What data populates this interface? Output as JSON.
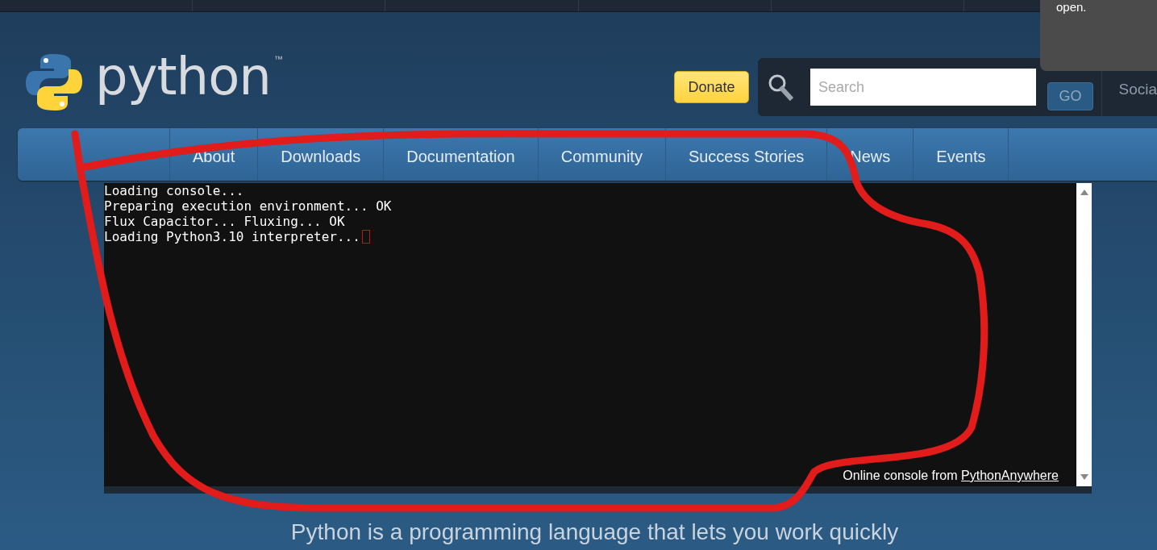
{
  "tooltip": {
    "text": "open."
  },
  "logo": {
    "wordmark": "python",
    "trademark": "™"
  },
  "donate_button": "Donate",
  "search": {
    "placeholder": "Search",
    "button": "GO"
  },
  "social": "Socia",
  "nav": [
    "About",
    "Downloads",
    "Documentation",
    "Community",
    "Success Stories",
    "News",
    "Events"
  ],
  "console": {
    "lines": [
      "Loading console...",
      "Preparing execution environment... OK",
      "Flux Capacitor... Fluxing... OK",
      "Loading Python3.10 interpreter..."
    ],
    "cursor": true,
    "footer_text": "Online console from",
    "footer_link": "PythonAnywhere"
  },
  "tagline": "Python is a programming language that lets you work quickly"
}
